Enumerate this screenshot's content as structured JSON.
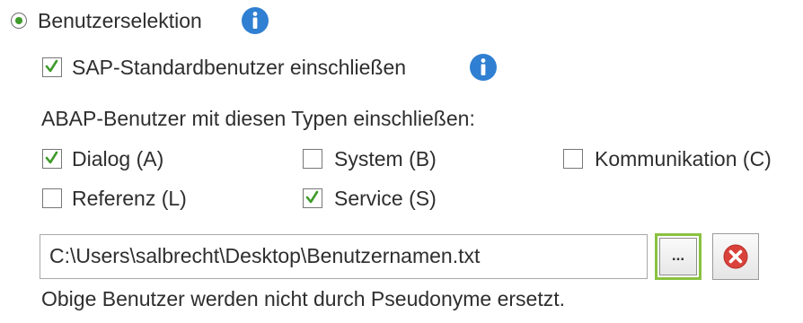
{
  "benutzerselektion": {
    "label": "Benutzerselektion",
    "selected": true
  },
  "sap_standard": {
    "label": "SAP-Standardbenutzer einschließen",
    "checked": true
  },
  "abap_types": {
    "heading": "ABAP-Benutzer mit diesen Typen einschließen:",
    "options": [
      {
        "label": "Dialog (A)",
        "checked": true
      },
      {
        "label": "System (B)",
        "checked": false
      },
      {
        "label": "Kommunikation (C)",
        "checked": false
      },
      {
        "label": "Referenz (L)",
        "checked": false
      },
      {
        "label": "Service (S)",
        "checked": true
      }
    ]
  },
  "file": {
    "path": "C:\\Users\\salbrecht\\Desktop\\Benutzernamen.txt",
    "browse_label": "...",
    "browse_icon": "ellipsis-icon",
    "remove_icon": "red-circle-x-icon"
  },
  "note": "Obige Benutzer werden nicht durch Pseudonyme ersetzt.",
  "colors": {
    "accent_green": "#3f9a29",
    "info_blue": "#2f7fd2",
    "remove_red": "#d9413a",
    "browse_border": "#89c23f"
  }
}
